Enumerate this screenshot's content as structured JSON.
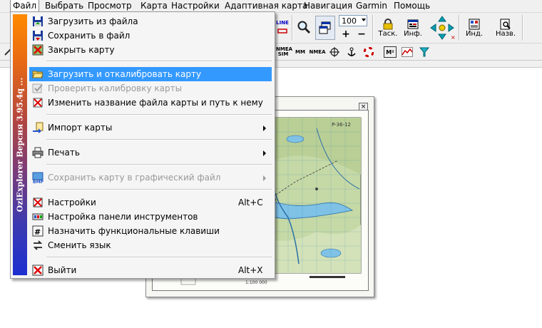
{
  "menubar": {
    "items": [
      "Файл",
      "Выбрать",
      "Просмотр",
      "Карта",
      "Настройки",
      "Адаптивная карта",
      "Навигация",
      "Garmin",
      "Помощь"
    ]
  },
  "toolbar": {
    "line_label": "LINE",
    "zoom_value": "100",
    "zoom_in": "+",
    "zoom_out": "−",
    "task_label": "Таск.",
    "info_label": "Инф.",
    "ind_label": "Инд.",
    "name_label": "Назв.",
    "nmea_sim_label": "NMEA SIM",
    "mm_label": "MM",
    "nmea_label": "NMEA",
    "m2_label": "M²"
  },
  "file_menu": {
    "banner": "OziExplorer  Версия 3.95.4q ...",
    "items": [
      {
        "label": "Загрузить из файла",
        "icon": "floppy-load-icon"
      },
      {
        "label": "Сохранить в файл",
        "icon": "floppy-save-icon"
      },
      {
        "label": "Закрыть карту",
        "icon": "close-map-icon"
      },
      {
        "label": "Загрузить и откалибровать карту",
        "icon": "folder-open-icon",
        "highlighted": true
      },
      {
        "label": "Проверить калибровку карты",
        "icon": "check-calibration-icon",
        "disabled": true
      },
      {
        "label": "Изменить название файла карты и путь к нему",
        "icon": "rename-map-icon"
      },
      {
        "label": "Импорт карты",
        "icon": "import-icon",
        "submenu": true
      },
      {
        "label": "Печать",
        "icon": "printer-icon",
        "submenu": true
      },
      {
        "label": "Сохранить карту в графический файл",
        "icon": "bmp-icon",
        "submenu": true,
        "disabled": true
      },
      {
        "label": "Настройки",
        "icon": "settings-icon",
        "shortcut": "Alt+C"
      },
      {
        "label": "Настройка панели инструментов",
        "icon": "toolbar-settings-icon"
      },
      {
        "label": "Назначить функциональные клавиши",
        "icon": "function-keys-icon"
      },
      {
        "label": "Сменить язык",
        "icon": "language-icon"
      },
      {
        "label": "Выйти",
        "icon": "exit-icon",
        "shortcut": "Alt+X"
      }
    ]
  },
  "map_window": {
    "sheet_code": "P-36-12",
    "close_label": "×",
    "scale_label": "1:100 000"
  }
}
